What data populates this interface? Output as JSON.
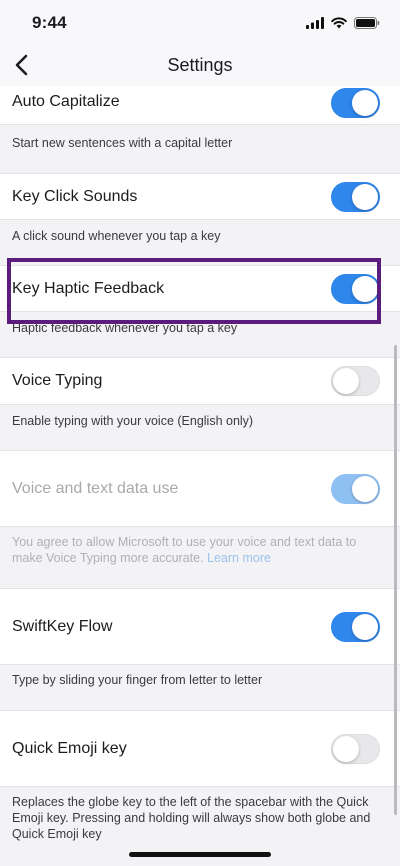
{
  "status": {
    "time": "9:44"
  },
  "nav": {
    "title": "Settings"
  },
  "settings": [
    {
      "label": "Auto Capitalize",
      "on": true,
      "disabled": false,
      "description": "Start new sentences with a capital letter"
    },
    {
      "label": "Key Click Sounds",
      "on": true,
      "disabled": false,
      "description": "A click sound whenever you tap a key"
    },
    {
      "label": "Key Haptic Feedback",
      "on": true,
      "disabled": false,
      "description": "Haptic feedback whenever you tap a key"
    },
    {
      "label": "Voice Typing",
      "on": false,
      "disabled": false,
      "description": "Enable typing with your voice (English only)"
    },
    {
      "label": "Voice and text data use",
      "on": true,
      "disabled": true,
      "description": "You agree to allow Microsoft to use your voice and text data to make Voice Typing more accurate.",
      "link": "Learn more"
    },
    {
      "label": "SwiftKey Flow",
      "on": true,
      "disabled": false,
      "description": "Type by sliding your finger from letter to letter"
    },
    {
      "label": "Quick Emoji key",
      "on": false,
      "disabled": false,
      "description": "Replaces the globe key to the left of the spacebar with the Quick Emoji key. Pressing and holding will always show both globe and Quick Emoji key"
    }
  ],
  "colors": {
    "accent": "#2f86eb",
    "highlight_frame": "#5a1d7e"
  }
}
